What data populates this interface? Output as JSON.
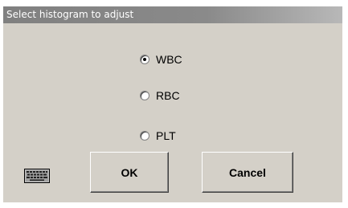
{
  "dialog": {
    "title": "Select histogram to adjust"
  },
  "options": [
    {
      "label": "WBC",
      "selected": true
    },
    {
      "label": "RBC",
      "selected": false
    },
    {
      "label": "PLT",
      "selected": false
    }
  ],
  "buttons": {
    "ok_label": "OK",
    "cancel_label": "Cancel"
  },
  "icons": {
    "keyboard": "keyboard-icon"
  }
}
